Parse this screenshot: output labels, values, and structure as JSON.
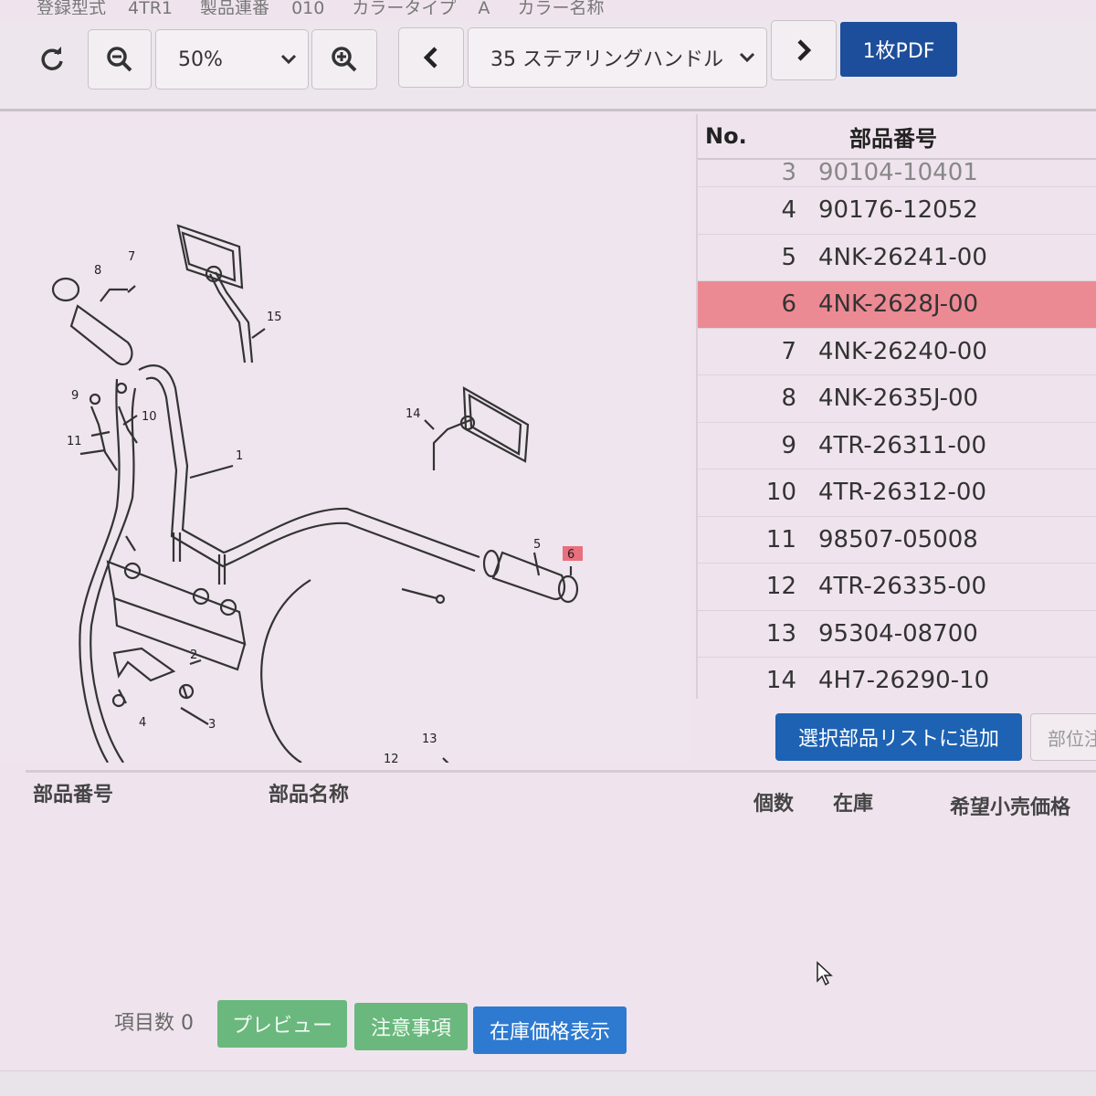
{
  "top_info": {
    "model_label": "登録型式",
    "model_value": "4TR1",
    "serial_label": "製品連番",
    "serial_value": "010",
    "color_type_label": "カラータイプ",
    "color_type_value": "A",
    "color_name_label": "カラー名称"
  },
  "toolbar": {
    "zoom_value": "50%",
    "section_value": "35 ステアリングハンドル",
    "pdf_label": "1枚PDF"
  },
  "parts_table": {
    "header_no": "No.",
    "header_part_number": "部品番号",
    "rows": [
      {
        "no": "3",
        "part_number": "90104-10401",
        "selected": false
      },
      {
        "no": "4",
        "part_number": "90176-12052",
        "selected": false
      },
      {
        "no": "5",
        "part_number": "4NK-26241-00",
        "selected": false
      },
      {
        "no": "6",
        "part_number": "4NK-2628J-00",
        "selected": true
      },
      {
        "no": "7",
        "part_number": "4NK-26240-00",
        "selected": false
      },
      {
        "no": "8",
        "part_number": "4NK-2635J-00",
        "selected": false
      },
      {
        "no": "9",
        "part_number": "4TR-26311-00",
        "selected": false
      },
      {
        "no": "10",
        "part_number": "4TR-26312-00",
        "selected": false
      },
      {
        "no": "11",
        "part_number": "98507-05008",
        "selected": false
      },
      {
        "no": "12",
        "part_number": "4TR-26335-00",
        "selected": false
      },
      {
        "no": "13",
        "part_number": "95304-08700",
        "selected": false
      },
      {
        "no": "14",
        "part_number": "4H7-26290-10",
        "selected": false
      }
    ]
  },
  "add_button_label": "選択部品リストに追加",
  "position_button_label": "部位注",
  "diagram_labels": {
    "l1": "1",
    "l2": "2",
    "l3": "3",
    "l4": "4",
    "l5": "5",
    "l6": "6",
    "l7": "7",
    "l8": "8",
    "l9": "9",
    "l10": "10",
    "l11": "11",
    "l12": "12",
    "l13": "13",
    "l14": "14",
    "l15": "15"
  },
  "selected_list": {
    "col_part_number": "部品番号",
    "col_part_name": "部品名称",
    "col_qty": "個数",
    "col_stock": "在庫",
    "col_price": "希望小売価格"
  },
  "bottom": {
    "count_label": "項目数",
    "count_value": "0",
    "preview_label": "プレビュー",
    "notes_label": "注意事項",
    "stock_price_label": "在庫価格表示"
  },
  "colors": {
    "selected_row": "#ec8a94",
    "primary_blue": "#1d62b3",
    "pdf_blue": "#1d4e9b",
    "green": "#6ab87d",
    "highlight_tag": "#e8707c"
  },
  "icons": {
    "refresh": "refresh-icon",
    "zoom_out": "zoom-out-icon",
    "zoom_in": "zoom-in-icon",
    "prev": "chevron-left-icon",
    "next": "chevron-right-icon",
    "dropdown": "chevron-down-icon"
  }
}
